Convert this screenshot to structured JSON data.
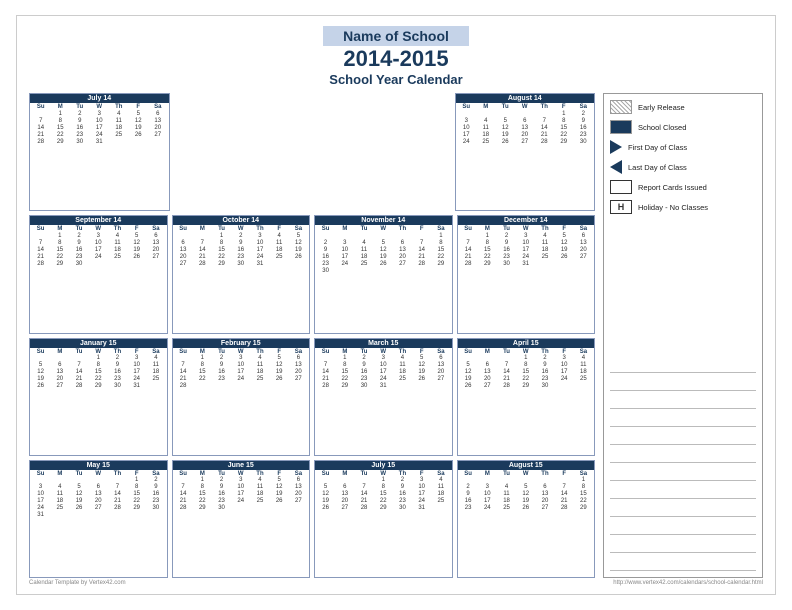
{
  "header": {
    "school_name": "Name of School",
    "year": "2014-2015",
    "subtitle": "School Year Calendar"
  },
  "legend": {
    "items": [
      {
        "id": "early-release",
        "icon": "hatch",
        "label": "Early Release"
      },
      {
        "id": "school-closed",
        "icon": "solid-blue",
        "label": "School Closed"
      },
      {
        "id": "first-day",
        "icon": "triangle-right",
        "label": "First Day of Class"
      },
      {
        "id": "last-day",
        "icon": "triangle-left",
        "label": "Last Day of Class"
      },
      {
        "id": "report-cards",
        "icon": "square",
        "label": "Report Cards Issued"
      },
      {
        "id": "holiday",
        "icon": "h-box",
        "label": "Holiday - No Classes"
      }
    ]
  },
  "footer": {
    "left": "Calendar Template by Vertex42.com",
    "right": "http://www.vertex42.com/calendars/school-calendar.html"
  },
  "months": [
    {
      "title": "July 14",
      "days": [
        "",
        "1",
        "2",
        "3",
        "4",
        "5",
        "6",
        "7",
        "8",
        "9",
        "10",
        "11",
        "12",
        "13",
        "14",
        "15",
        "16",
        "17",
        "18",
        "19",
        "20",
        "21",
        "22",
        "23",
        "24",
        "25",
        "26",
        "27",
        "28",
        "29",
        "30",
        "31"
      ]
    },
    {
      "title": "August 14",
      "days": [
        "",
        "",
        "",
        "",
        "",
        "1",
        "2",
        "3",
        "4",
        "5",
        "6",
        "7",
        "8",
        "9",
        "10",
        "11",
        "12",
        "13",
        "14",
        "15",
        "16",
        "17",
        "18",
        "19",
        "20",
        "21",
        "22",
        "23",
        "24",
        "25",
        "26",
        "27",
        "28",
        "29",
        "30"
      ]
    },
    {
      "title": "September 14",
      "days": [
        "",
        "1",
        "2",
        "3",
        "4",
        "5",
        "6",
        "7",
        "8",
        "9",
        "10",
        "11",
        "12",
        "13",
        "14",
        "15",
        "16",
        "17",
        "18",
        "19",
        "20",
        "21",
        "22",
        "23",
        "24",
        "25",
        "26",
        "27",
        "28",
        "29",
        "30"
      ]
    },
    {
      "title": "October 14",
      "days": [
        "",
        "",
        "1",
        "2",
        "3",
        "4",
        "5",
        "6",
        "7",
        "8",
        "9",
        "10",
        "11",
        "12",
        "13",
        "14",
        "15",
        "16",
        "17",
        "18",
        "19",
        "20",
        "21",
        "22",
        "23",
        "24",
        "25",
        "26",
        "27",
        "28",
        "29",
        "30",
        "31"
      ]
    },
    {
      "title": "November 14",
      "days": [
        "",
        "",
        "",
        "",
        "",
        "",
        "1",
        "2",
        "3",
        "4",
        "5",
        "6",
        "7",
        "8",
        "9",
        "10",
        "11",
        "12",
        "13",
        "14",
        "15",
        "16",
        "17",
        "18",
        "19",
        "20",
        "21",
        "22",
        "23",
        "24",
        "25",
        "26",
        "27",
        "28",
        "29",
        "30"
      ]
    },
    {
      "title": "December 14",
      "days": [
        "",
        "1",
        "2",
        "3",
        "4",
        "5",
        "6",
        "7",
        "8",
        "9",
        "10",
        "11",
        "12",
        "13",
        "14",
        "15",
        "16",
        "17",
        "18",
        "19",
        "20",
        "21",
        "22",
        "23",
        "24",
        "25",
        "26",
        "27",
        "28",
        "29",
        "30",
        "31"
      ]
    },
    {
      "title": "January 15",
      "days": [
        "",
        "",
        "",
        "1",
        "2",
        "3",
        "4",
        "5",
        "6",
        "7",
        "8",
        "9",
        "10",
        "11",
        "12",
        "13",
        "14",
        "15",
        "16",
        "17",
        "18",
        "19",
        "20",
        "21",
        "22",
        "23",
        "24",
        "25",
        "26",
        "27",
        "28",
        "29",
        "30",
        "31"
      ]
    },
    {
      "title": "February 15",
      "days": [
        "",
        "1",
        "2",
        "3",
        "4",
        "5",
        "6",
        "7",
        "8",
        "9",
        "10",
        "11",
        "12",
        "13",
        "14",
        "15",
        "16",
        "17",
        "18",
        "19",
        "20",
        "21",
        "22",
        "23",
        "24",
        "25",
        "26",
        "27",
        "28"
      ]
    },
    {
      "title": "March 15",
      "days": [
        "",
        "1",
        "2",
        "3",
        "4",
        "5",
        "6",
        "7",
        "8",
        "9",
        "10",
        "11",
        "12",
        "13",
        "14",
        "15",
        "16",
        "17",
        "18",
        "19",
        "20",
        "21",
        "22",
        "23",
        "24",
        "25",
        "26",
        "27",
        "28",
        "29",
        "30",
        "31"
      ]
    },
    {
      "title": "April 15",
      "days": [
        "",
        "",
        "",
        "1",
        "2",
        "3",
        "4",
        "5",
        "6",
        "7",
        "8",
        "9",
        "10",
        "11",
        "12",
        "13",
        "14",
        "15",
        "16",
        "17",
        "18",
        "19",
        "20",
        "21",
        "22",
        "23",
        "24",
        "25",
        "26",
        "27",
        "28",
        "29",
        "30"
      ]
    },
    {
      "title": "May 15",
      "days": [
        "",
        "",
        "",
        "",
        "",
        "1",
        "2",
        "3",
        "4",
        "5",
        "6",
        "7",
        "8",
        "9",
        "10",
        "11",
        "12",
        "13",
        "14",
        "15",
        "16",
        "17",
        "18",
        "19",
        "20",
        "21",
        "22",
        "23",
        "24",
        "25",
        "26",
        "27",
        "28",
        "29",
        "30",
        "31"
      ]
    },
    {
      "title": "June 15",
      "days": [
        "",
        "1",
        "2",
        "3",
        "4",
        "5",
        "6",
        "7",
        "8",
        "9",
        "10",
        "11",
        "12",
        "13",
        "14",
        "15",
        "16",
        "17",
        "18",
        "19",
        "20",
        "21",
        "22",
        "23",
        "24",
        "25",
        "26",
        "27",
        "28",
        "29",
        "30"
      ]
    },
    {
      "title": "July 15",
      "days": [
        "",
        "",
        "",
        "1",
        "2",
        "3",
        "4",
        "5",
        "6",
        "7",
        "8",
        "9",
        "10",
        "11",
        "12",
        "13",
        "14",
        "15",
        "16",
        "17",
        "18",
        "19",
        "20",
        "21",
        "22",
        "23",
        "24",
        "25",
        "26",
        "27",
        "28",
        "29",
        "30",
        "31"
      ]
    },
    {
      "title": "August 15",
      "days": [
        "",
        "",
        "",
        "",
        "",
        "",
        "1",
        "2",
        "3",
        "4",
        "5",
        "6",
        "7",
        "8",
        "9",
        "10",
        "11",
        "12",
        "13",
        "14",
        "15",
        "16",
        "17",
        "18",
        "19",
        "20",
        "21",
        "22",
        "23",
        "24",
        "25",
        "26",
        "27",
        "28",
        "29"
      ]
    }
  ],
  "dow_headers": [
    "Su",
    "M",
    "Tu",
    "W",
    "Th",
    "F",
    "Sa"
  ]
}
